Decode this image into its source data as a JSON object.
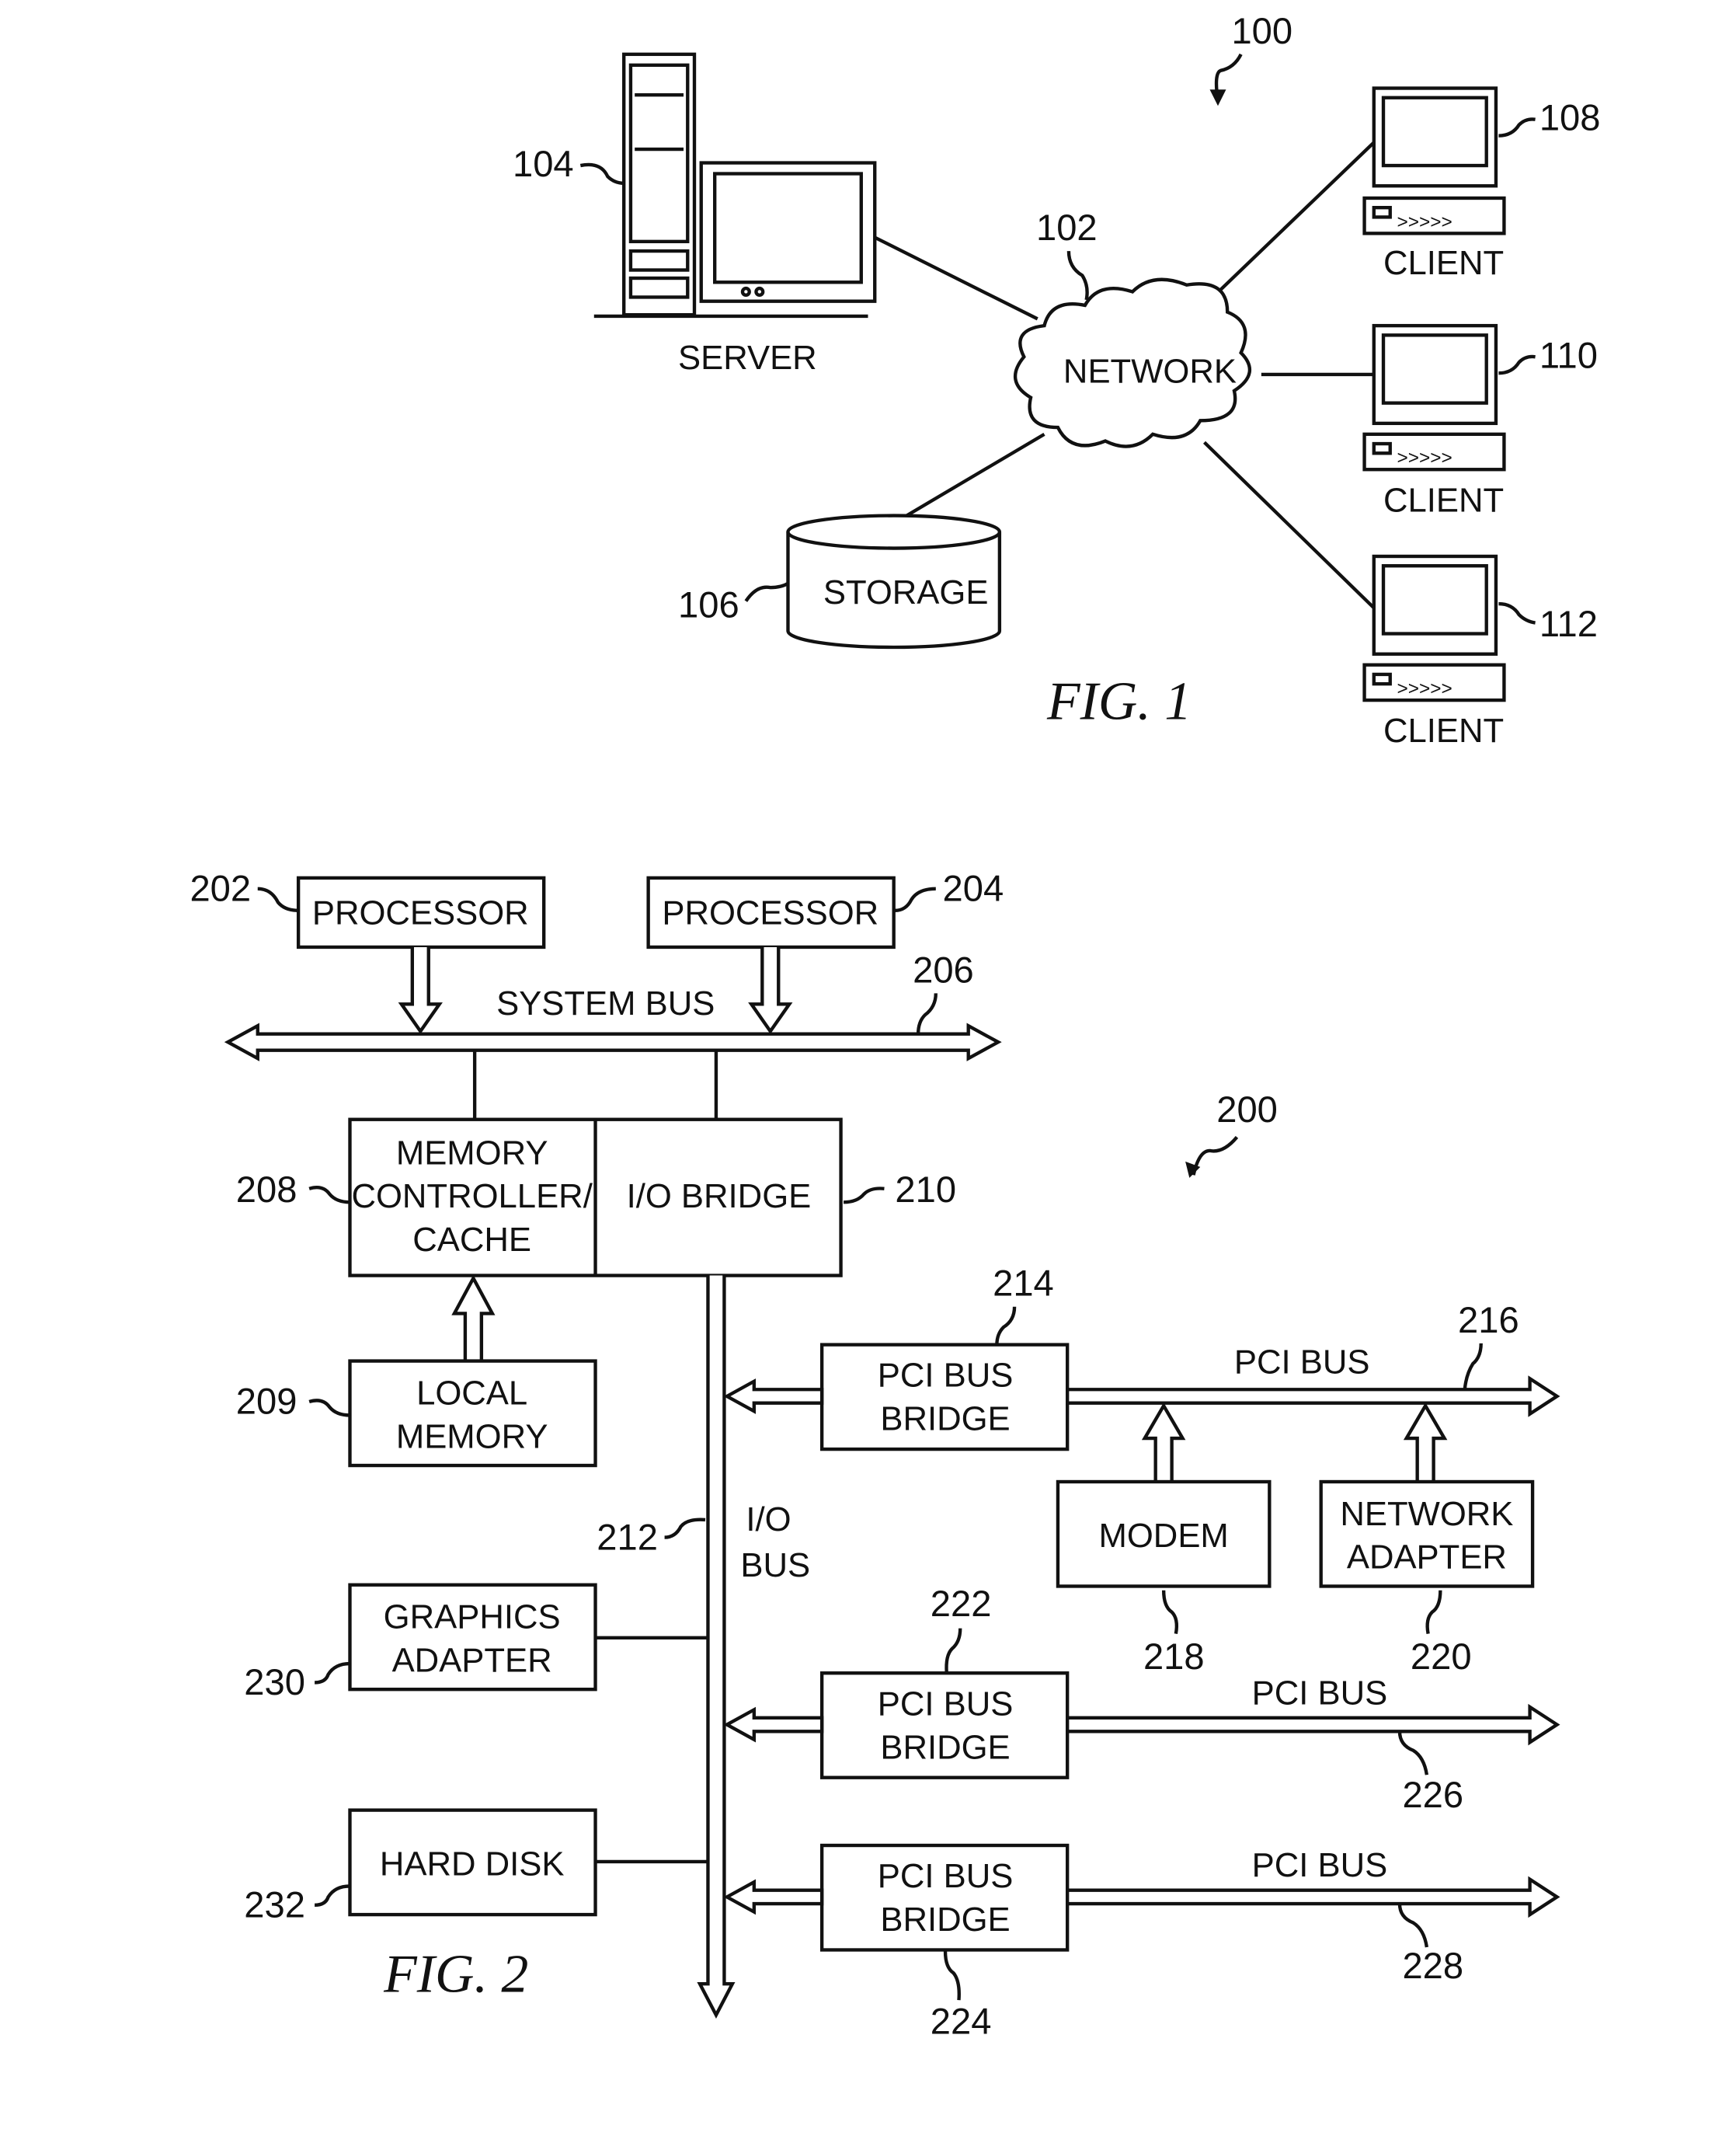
{
  "fig1": {
    "caption": "FIG. 1",
    "ref": "100",
    "network": {
      "label": "NETWORK",
      "ref": "102"
    },
    "server": {
      "label": "SERVER",
      "ref": "104"
    },
    "storage": {
      "label": "STORAGE",
      "ref": "106"
    },
    "clients": [
      {
        "label": "CLIENT",
        "ref": "108"
      },
      {
        "label": "CLIENT",
        "ref": "110"
      },
      {
        "label": "CLIENT",
        "ref": "112"
      }
    ]
  },
  "fig2": {
    "caption": "FIG. 2",
    "ref": "200",
    "processor1": {
      "label": "PROCESSOR",
      "ref": "202"
    },
    "processor2": {
      "label": "PROCESSOR",
      "ref": "204"
    },
    "system_bus": {
      "label": "SYSTEM BUS",
      "ref": "206"
    },
    "mem_ctrl": {
      "lines": [
        "MEMORY",
        "CONTROLLER/",
        "CACHE"
      ],
      "ref": "208"
    },
    "local_mem": {
      "lines": [
        "LOCAL",
        "MEMORY"
      ],
      "ref": "209"
    },
    "io_bridge": {
      "label": "I/O BRIDGE",
      "ref": "210"
    },
    "io_bus": {
      "lines": [
        "I/O",
        "BUS"
      ],
      "ref": "212"
    },
    "pci_bridge1": {
      "lines": [
        "PCI BUS",
        "BRIDGE"
      ],
      "ref": "214"
    },
    "pci_bus1": {
      "label": "PCI BUS",
      "ref": "216"
    },
    "modem": {
      "label": "MODEM",
      "ref": "218"
    },
    "net_adapter": {
      "lines": [
        "NETWORK",
        "ADAPTER"
      ],
      "ref": "220"
    },
    "pci_bridge2": {
      "lines": [
        "PCI BUS",
        "BRIDGE"
      ],
      "ref": "222"
    },
    "pci_bridge3": {
      "lines": [
        "PCI BUS",
        "BRIDGE"
      ],
      "ref": "224"
    },
    "pci_bus2": {
      "label": "PCI BUS",
      "ref": "226"
    },
    "pci_bus3": {
      "label": "PCI BUS",
      "ref": "228"
    },
    "graphics": {
      "lines": [
        "GRAPHICS",
        "ADAPTER"
      ],
      "ref": "230"
    },
    "hard_disk": {
      "label": "HARD DISK",
      "ref": "232"
    }
  }
}
